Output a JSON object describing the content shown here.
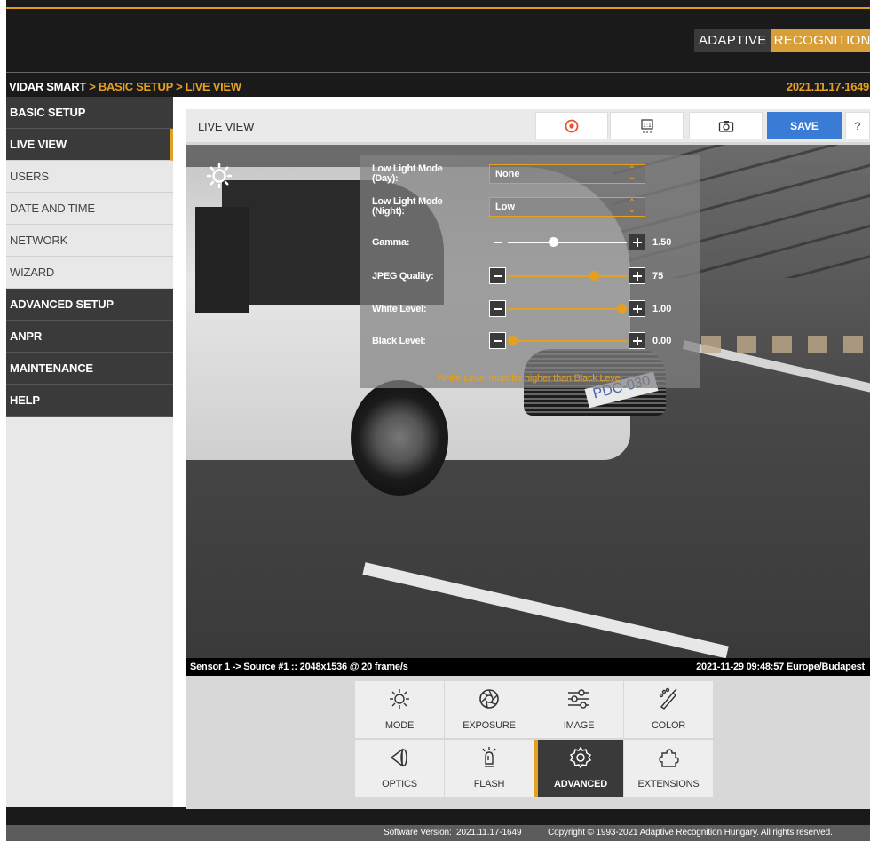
{
  "brand": {
    "part1": "ADAPTIVE",
    "part2": "RECOGNITION"
  },
  "breadcrumb": {
    "root": "VIDAR SMART",
    "sep1": " > ",
    "level1": "BASIC SETUP",
    "sep2": " > ",
    "level2": "LIVE VIEW"
  },
  "version_top": "2021.11.17-1649",
  "sidebar": {
    "items": [
      {
        "label": "BASIC SETUP"
      },
      {
        "label": "LIVE VIEW"
      },
      {
        "label": "USERS"
      },
      {
        "label": "DATE AND TIME"
      },
      {
        "label": "NETWORK"
      },
      {
        "label": "WIZARD"
      },
      {
        "label": "ADVANCED SETUP"
      },
      {
        "label": "ANPR"
      },
      {
        "label": "MAINTENANCE"
      },
      {
        "label": "HELP"
      }
    ]
  },
  "panel": {
    "title": "LIVE VIEW",
    "toolbar": {
      "save_label": "SAVE",
      "help_label": "?"
    }
  },
  "overlay": {
    "low_light_day": {
      "label": "Low Light Mode (Day):",
      "value": "None"
    },
    "low_light_night": {
      "label": "Low Light Mode (Night):",
      "value": "Low"
    },
    "gamma": {
      "label": "Gamma:",
      "value": "1.50",
      "level": 0.37
    },
    "jpeg_quality": {
      "label": "JPEG Quality:",
      "value": "75",
      "level": 0.75
    },
    "white_level": {
      "label": "White Level:",
      "value": "1.00",
      "level": 1.0
    },
    "black_level": {
      "label": "Black Level:",
      "value": "0.00",
      "level": 0.0
    },
    "warning": "White Level must be higher than Black Level"
  },
  "statusbar": {
    "source": "Sensor 1 -> Source #1 :: 2048x1536 @ 20 frame/s",
    "datetime": "2021-11-29 09:48:57 Europe/Budapest"
  },
  "plate_text": "PDC-030",
  "tools": [
    {
      "label": "MODE",
      "icon": "sun-icon"
    },
    {
      "label": "EXPOSURE",
      "icon": "aperture-icon"
    },
    {
      "label": "IMAGE",
      "icon": "sliders-icon"
    },
    {
      "label": "COLOR",
      "icon": "palette-icon"
    },
    {
      "label": "OPTICS",
      "icon": "lens-icon"
    },
    {
      "label": "FLASH",
      "icon": "flash-icon"
    },
    {
      "label": "ADVANCED",
      "icon": "gear-icon"
    },
    {
      "label": "EXTENSIONS",
      "icon": "puzzle-icon"
    }
  ],
  "footer": {
    "version_label": "Software Version:",
    "version": "2021.11.17-1649",
    "copyright": "Copyright © 1993-2021 Adaptive Recognition Hungary. All rights reserved."
  },
  "colors": {
    "accent": "#e4a020",
    "dark": "#3a3a3a",
    "save": "#3a7bd5",
    "record": "#e5532e"
  }
}
